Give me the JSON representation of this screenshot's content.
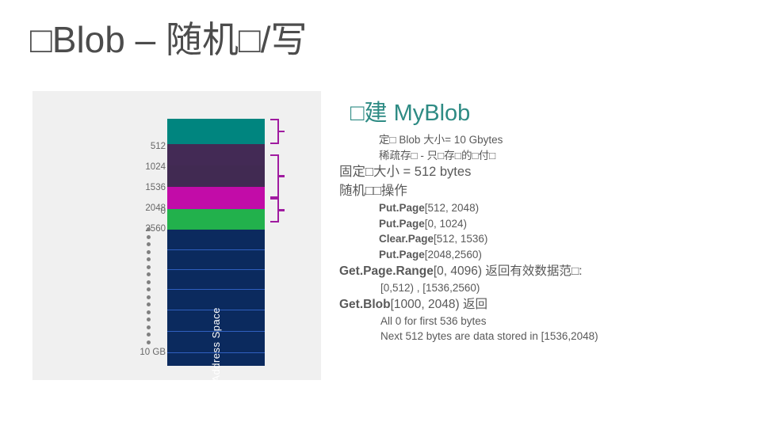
{
  "slide": {
    "title": "□Blob – 随机□/写"
  },
  "diagram": {
    "name": "address-space-diagram",
    "axis_labels": [
      "0",
      "512",
      "1024",
      "1536",
      "2048",
      "2560"
    ],
    "bottom_label": "10 GB",
    "vertical_label": "Address Space",
    "blocks": [
      {
        "name": "page-0-512",
        "range": "[0, 512)",
        "color": "#00857f"
      },
      {
        "name": "page-512-1024",
        "range": "[512, 1024)",
        "color": "#432a55"
      },
      {
        "name": "page-1024-1536",
        "range": "[1024, 1536)",
        "color": "#412a52"
      },
      {
        "name": "page-1536-2048",
        "range": "[1536, 2048)",
        "color": "#c20ca8"
      },
      {
        "name": "page-2048-2560",
        "range": "[2048, 2560)",
        "color": "#22b14c"
      },
      {
        "name": "page-2560-end",
        "range": "[2560, 10GB)",
        "color": "#0b2a5e"
      }
    ],
    "braces": [
      {
        "name": "brace-0-512",
        "label": "[0, 512)"
      },
      {
        "name": "brace-1024-2048",
        "label": "[1024, 2048)"
      },
      {
        "name": "brace-2048-2560",
        "label": "[2048, 2560)"
      }
    ],
    "colors": {
      "panel_bg": "#f0f0f0",
      "brace": "#a01ba0",
      "navy_line": "#2f5fbf",
      "dot": "#808080"
    }
  },
  "content": {
    "heading": "□建 MyBlob",
    "lines": [
      {
        "level": 2,
        "text": "定□ Blob 大小= 10 Gbytes",
        "bold": false
      },
      {
        "level": 2,
        "text": "稀疏存□ - 只□存□的□付□",
        "bold": false
      },
      {
        "level": 1,
        "text": "固定□大小 = 512 bytes",
        "bold": false
      },
      {
        "level": 1,
        "text": "随机□□操作",
        "bold": false
      },
      {
        "level": 2,
        "text": "Put.Page[512, 2048)",
        "bold": true,
        "api": "Put.Page",
        "args": "[512, 2048)"
      },
      {
        "level": 2,
        "text": "Put.Page[0, 1024)",
        "bold": true,
        "api": "Put.Page",
        "args": "[0, 1024)"
      },
      {
        "level": 2,
        "text": "Clear.Page[512, 1536)",
        "bold": true,
        "api": "Clear.Page",
        "args": "[512, 1536)"
      },
      {
        "level": 2,
        "text": "Put.Page[2048,2560)",
        "bold": true,
        "api": "Put.Page",
        "args": "[2048,2560)"
      },
      {
        "level": 1,
        "text": "Get.Page.Range[0, 4096) 返回有效数据范□:",
        "bold": true,
        "api": "Get.Page.Range",
        "args": "[0, 4096) 返回有效数据范□:"
      },
      {
        "level": 3,
        "text": "[0,512) , [1536,2560)",
        "bold": false
      },
      {
        "level": 1,
        "text": "Get.Blob[1000, 2048) 返回",
        "bold": true,
        "api": "Get.Blob",
        "args": "[1000, 2048) 返回"
      },
      {
        "level": 3,
        "text": "All 0 for first 536 bytes",
        "bold": false
      },
      {
        "level": 3,
        "text": "Next 512 bytes are data stored in [1536,2048)",
        "bold": false
      }
    ],
    "heading_color": "#2e8b84",
    "text_color": "#595959"
  }
}
